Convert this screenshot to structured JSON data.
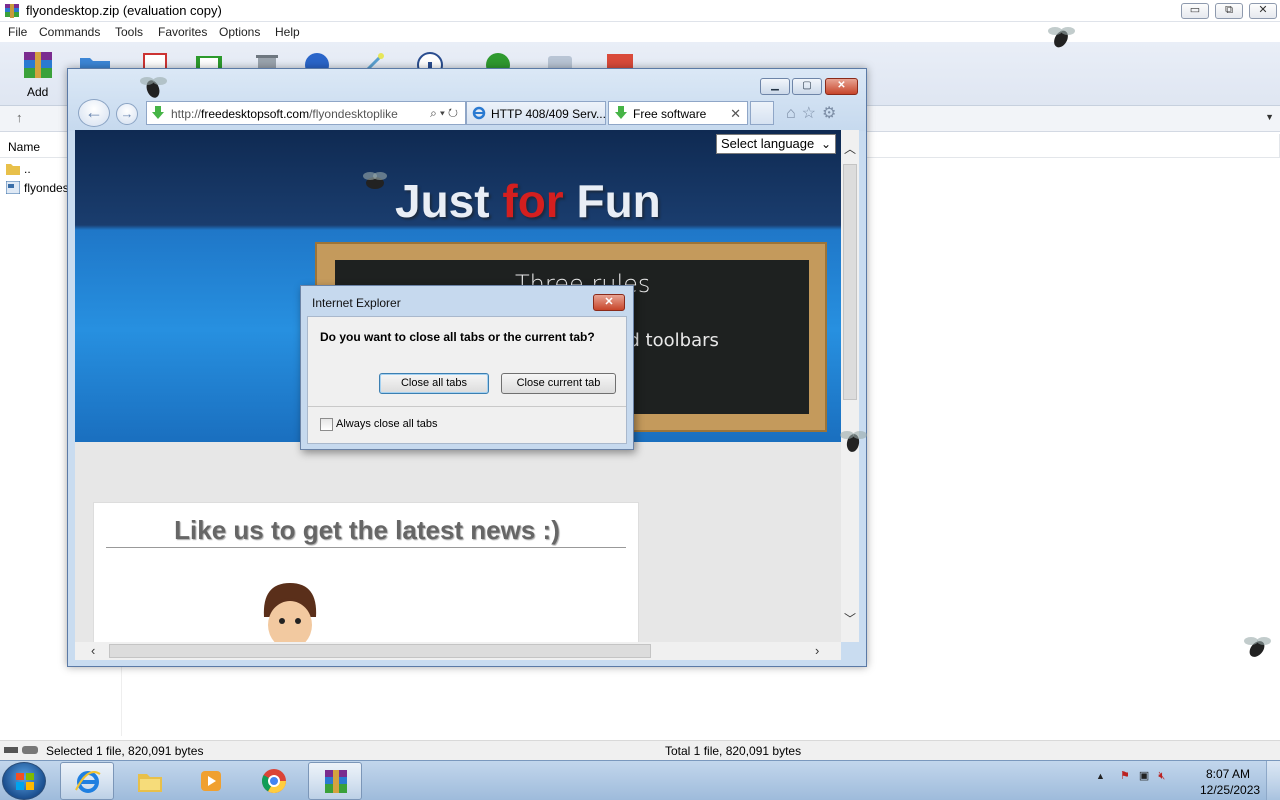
{
  "winrar": {
    "title": "flyondesktop.zip (evaluation copy)",
    "window_buttons": {
      "minimize": "▭",
      "restore": "⧉",
      "close": "✕"
    },
    "menu": [
      "File",
      "Commands",
      "Tools",
      "Favorites",
      "Options",
      "Help"
    ],
    "toolbar": {
      "add_label": "Add"
    },
    "column_name": "Name",
    "files": [
      {
        "name": "..",
        "icon": "folder-icon"
      },
      {
        "name": "flyondes",
        "icon": "file-icon"
      }
    ],
    "status_left": "Selected 1 file, 820,091 bytes",
    "status_right": "Total 1 file, 820,091 bytes"
  },
  "ie": {
    "address_prefix": "http://",
    "address_domain": "freedesktopsoft.com",
    "address_path": "/flyondesktoplike",
    "tabs": [
      {
        "label": "HTTP 408/409 Serv...",
        "icon": "ie-icon",
        "active": false
      },
      {
        "label": "Free software",
        "icon": "download-icon",
        "active": true
      }
    ],
    "tab_close": "✕",
    "page": {
      "language_select": "Select language",
      "banner_word1": "Just ",
      "banner_word2": "for",
      "banner_word3": " Fun",
      "chalk_title": "Three rules",
      "chalk_line": "nd toolbars",
      "like_title": "Like us to get the latest news :)"
    }
  },
  "dialog": {
    "title": "Internet Explorer",
    "close": "✕",
    "question": "Do you want to close all tabs or the current tab?",
    "btn_all": "Close all tabs",
    "btn_current": "Close current tab",
    "checkbox_label": "Always close all tabs",
    "checkbox_checked": false
  },
  "taskbar": {
    "apps": [
      "internet-explorer",
      "file-explorer",
      "media-player",
      "chrome",
      "winrar"
    ],
    "time": "8:07 AM",
    "date": "12/25/2023",
    "tray_arrow": "▲"
  },
  "colors": {
    "taskbar": "#a9c4e2",
    "ie_frame": "#c6d9ee",
    "close_red": "#c7452a",
    "banner_red": "#d41f1f"
  }
}
